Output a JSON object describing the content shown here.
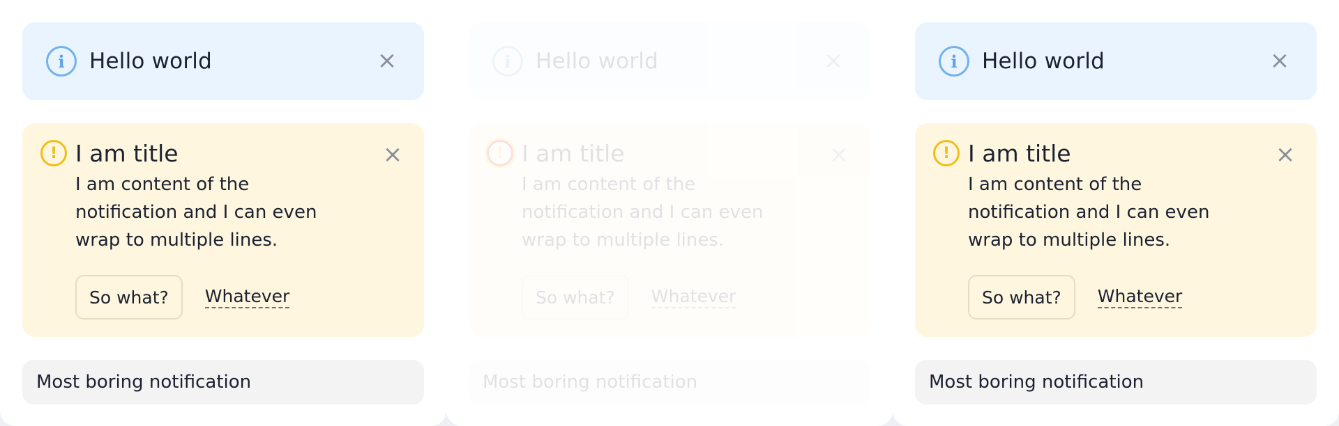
{
  "panels": [
    {
      "info": {
        "icon": "info-icon",
        "title": "Hello world",
        "close_icon": "close-icon",
        "close_glyph": "×"
      },
      "warning": {
        "icon": "warning-icon",
        "icon_glyph": "!",
        "title": "I am title",
        "content": "I am content of the notification and I can even wrap to multiple lines.",
        "primary_action": "So what?",
        "secondary_action": "Whatever",
        "close_glyph": "×"
      },
      "neutral": {
        "text": "Most boring notification"
      }
    },
    {
      "info": {
        "icon": "info-icon",
        "title": "Hello world",
        "close_icon": "close-icon",
        "close_glyph": "×"
      },
      "warning": {
        "icon": "warning-icon",
        "icon_glyph": "!",
        "title": "I am title",
        "content": "I am content of the notification and I can even wrap to multiple lines.",
        "primary_action": "So what?",
        "secondary_action": "Whatever",
        "close_glyph": "×"
      },
      "neutral": {
        "text": "Most boring notification"
      }
    },
    {
      "info": {
        "icon": "info-icon",
        "title": "Hello world",
        "close_icon": "close-icon",
        "close_glyph": "×"
      },
      "warning": {
        "icon": "warning-icon",
        "icon_glyph": "!",
        "title": "I am title",
        "content": "I am content of the notification and I can even wrap to multiple lines.",
        "primary_action": "So what?",
        "secondary_action": "Whatever",
        "close_glyph": "×"
      },
      "neutral": {
        "text": "Most boring notification"
      }
    }
  ],
  "colors": {
    "info_bg": "#eaf4fe",
    "info_icon": "#6fb2f0",
    "warning_bg": "#fef6de",
    "warning_icon": "#f2bd14",
    "neutral_bg": "#f3f3f4",
    "text": "#1b2130"
  }
}
